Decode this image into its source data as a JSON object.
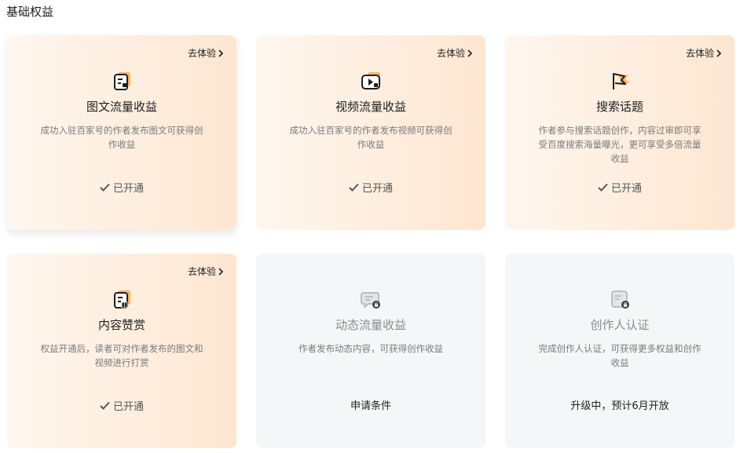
{
  "section": {
    "title": "基础权益"
  },
  "colors": {
    "accent": "#ff9a2e",
    "card_warm_start": "#fff7ef",
    "card_warm_end": "#fde6d1",
    "card_grey": "#f5f6f8"
  },
  "cards": [
    {
      "title": "图文流量收益",
      "desc": "成功入驻百家号的作者发布图文可获得创作收益",
      "try_label": "去体验",
      "status": "已开通",
      "icon": "article-doc-icon"
    },
    {
      "title": "视频流量收益",
      "desc": "成功入驻百家号的作者发布视频可获得创作收益",
      "try_label": "去体验",
      "status": "已开通",
      "icon": "video-play-icon"
    },
    {
      "title": "搜索话题",
      "desc": "作者参与搜索话题创作，内容过审即可享受百度搜索海量曝光，更可享受多倍流量收益",
      "try_label": "去体验",
      "status": "已开通",
      "icon": "flag-icon"
    },
    {
      "title": "内容赞赏",
      "desc": "权益开通后，读者可对作者发布的图文和视频进行打赏",
      "try_label": "去体验",
      "status": "已开通",
      "icon": "reward-doc-icon"
    },
    {
      "title": "动态流量收益",
      "desc": "作者发布动态内容，可获得创作收益",
      "action": "申请条件",
      "icon": "locked-chat-icon"
    },
    {
      "title": "创作人认证",
      "desc": "完成创作人认证，可获得更多权益和创作收益",
      "action": "升级中，预计6月开放",
      "icon": "locked-cert-icon"
    }
  ]
}
